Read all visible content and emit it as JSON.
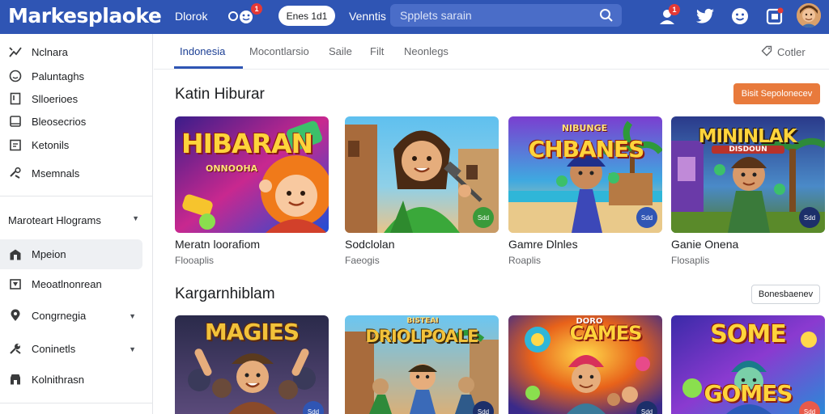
{
  "app": {
    "logo": "Markesplaoke"
  },
  "topbar": {
    "nav_link_1": "Dlorok",
    "pill_button": "Enes 1d1",
    "nav_link_2": "Venntis",
    "search_placeholder": "Spplets sarain",
    "left_badge_count": "1",
    "notif_badge_count": "1"
  },
  "sidebar": {
    "items": [
      {
        "label": "Nclnara",
        "icon": "trend-icon"
      },
      {
        "label": "Paluntaghs",
        "icon": "smile-icon"
      },
      {
        "label": "Slloerioes",
        "icon": "bookmark-icon"
      },
      {
        "label": "Bleosecrios",
        "icon": "tablet-icon"
      },
      {
        "label": "Ketonils",
        "icon": "calendar-icon"
      },
      {
        "label": "Msemnals",
        "icon": "tools-icon"
      }
    ],
    "group_header": "Maroteart Hlograms",
    "group_items": [
      {
        "label": "Mpeion",
        "icon": "store-icon"
      },
      {
        "label": "Meoatlnonrean",
        "icon": "box-icon"
      },
      {
        "label": "Congrnegia",
        "icon": "pin-icon"
      },
      {
        "label": "Coninetls",
        "icon": "wrench-icon"
      },
      {
        "label": "Kolnithrasn",
        "icon": "shop-icon"
      }
    ]
  },
  "tabs": {
    "items": [
      "Indonesia",
      "Mocontlarsio",
      "Saile",
      "Filt",
      "Neonlegs"
    ],
    "right_label": "Cotler"
  },
  "section1": {
    "title": "Katin Hiburar",
    "button": "Bisit Sepolonecev",
    "cards": [
      {
        "title": "Meratn loorafiom",
        "sub": "Flooaplis",
        "tag": "Sdd",
        "art": "HIBARAN",
        "art_sub": "ONNOOHA"
      },
      {
        "title": "Sodclolan",
        "sub": "Faeogis",
        "tag": "Sdd",
        "art": "",
        "art_sub": ""
      },
      {
        "title": "Gamre Dlnles",
        "sub": "Roaplis",
        "tag": "Sdd",
        "art": "CHBANES",
        "art_sub": "NIBUNGE"
      },
      {
        "title": "Ganie Onena",
        "sub": "Flosaplis",
        "tag": "Sdd",
        "art": "MININLAK",
        "art_sub": "DISDOUN"
      }
    ]
  },
  "section2": {
    "title": "Kargarnhiblam",
    "button": "Bonesbaenev",
    "cards": [
      {
        "tag": "Sdd",
        "art": "MAGIES",
        "art_sub": ""
      },
      {
        "tag": "Sdd",
        "art": "DRIOLPOALE",
        "art_sub": "BISTEAI"
      },
      {
        "tag": "Sdd",
        "art": "CAMES",
        "art_sub": "DORO"
      },
      {
        "tag": "Sdd",
        "art": "SOME",
        "art_sub": "GOMES"
      }
    ]
  },
  "colors": {
    "topbar": "#2f55b4",
    "accent_orange": "#e87a3c",
    "tab_active": "#1c3f94"
  }
}
